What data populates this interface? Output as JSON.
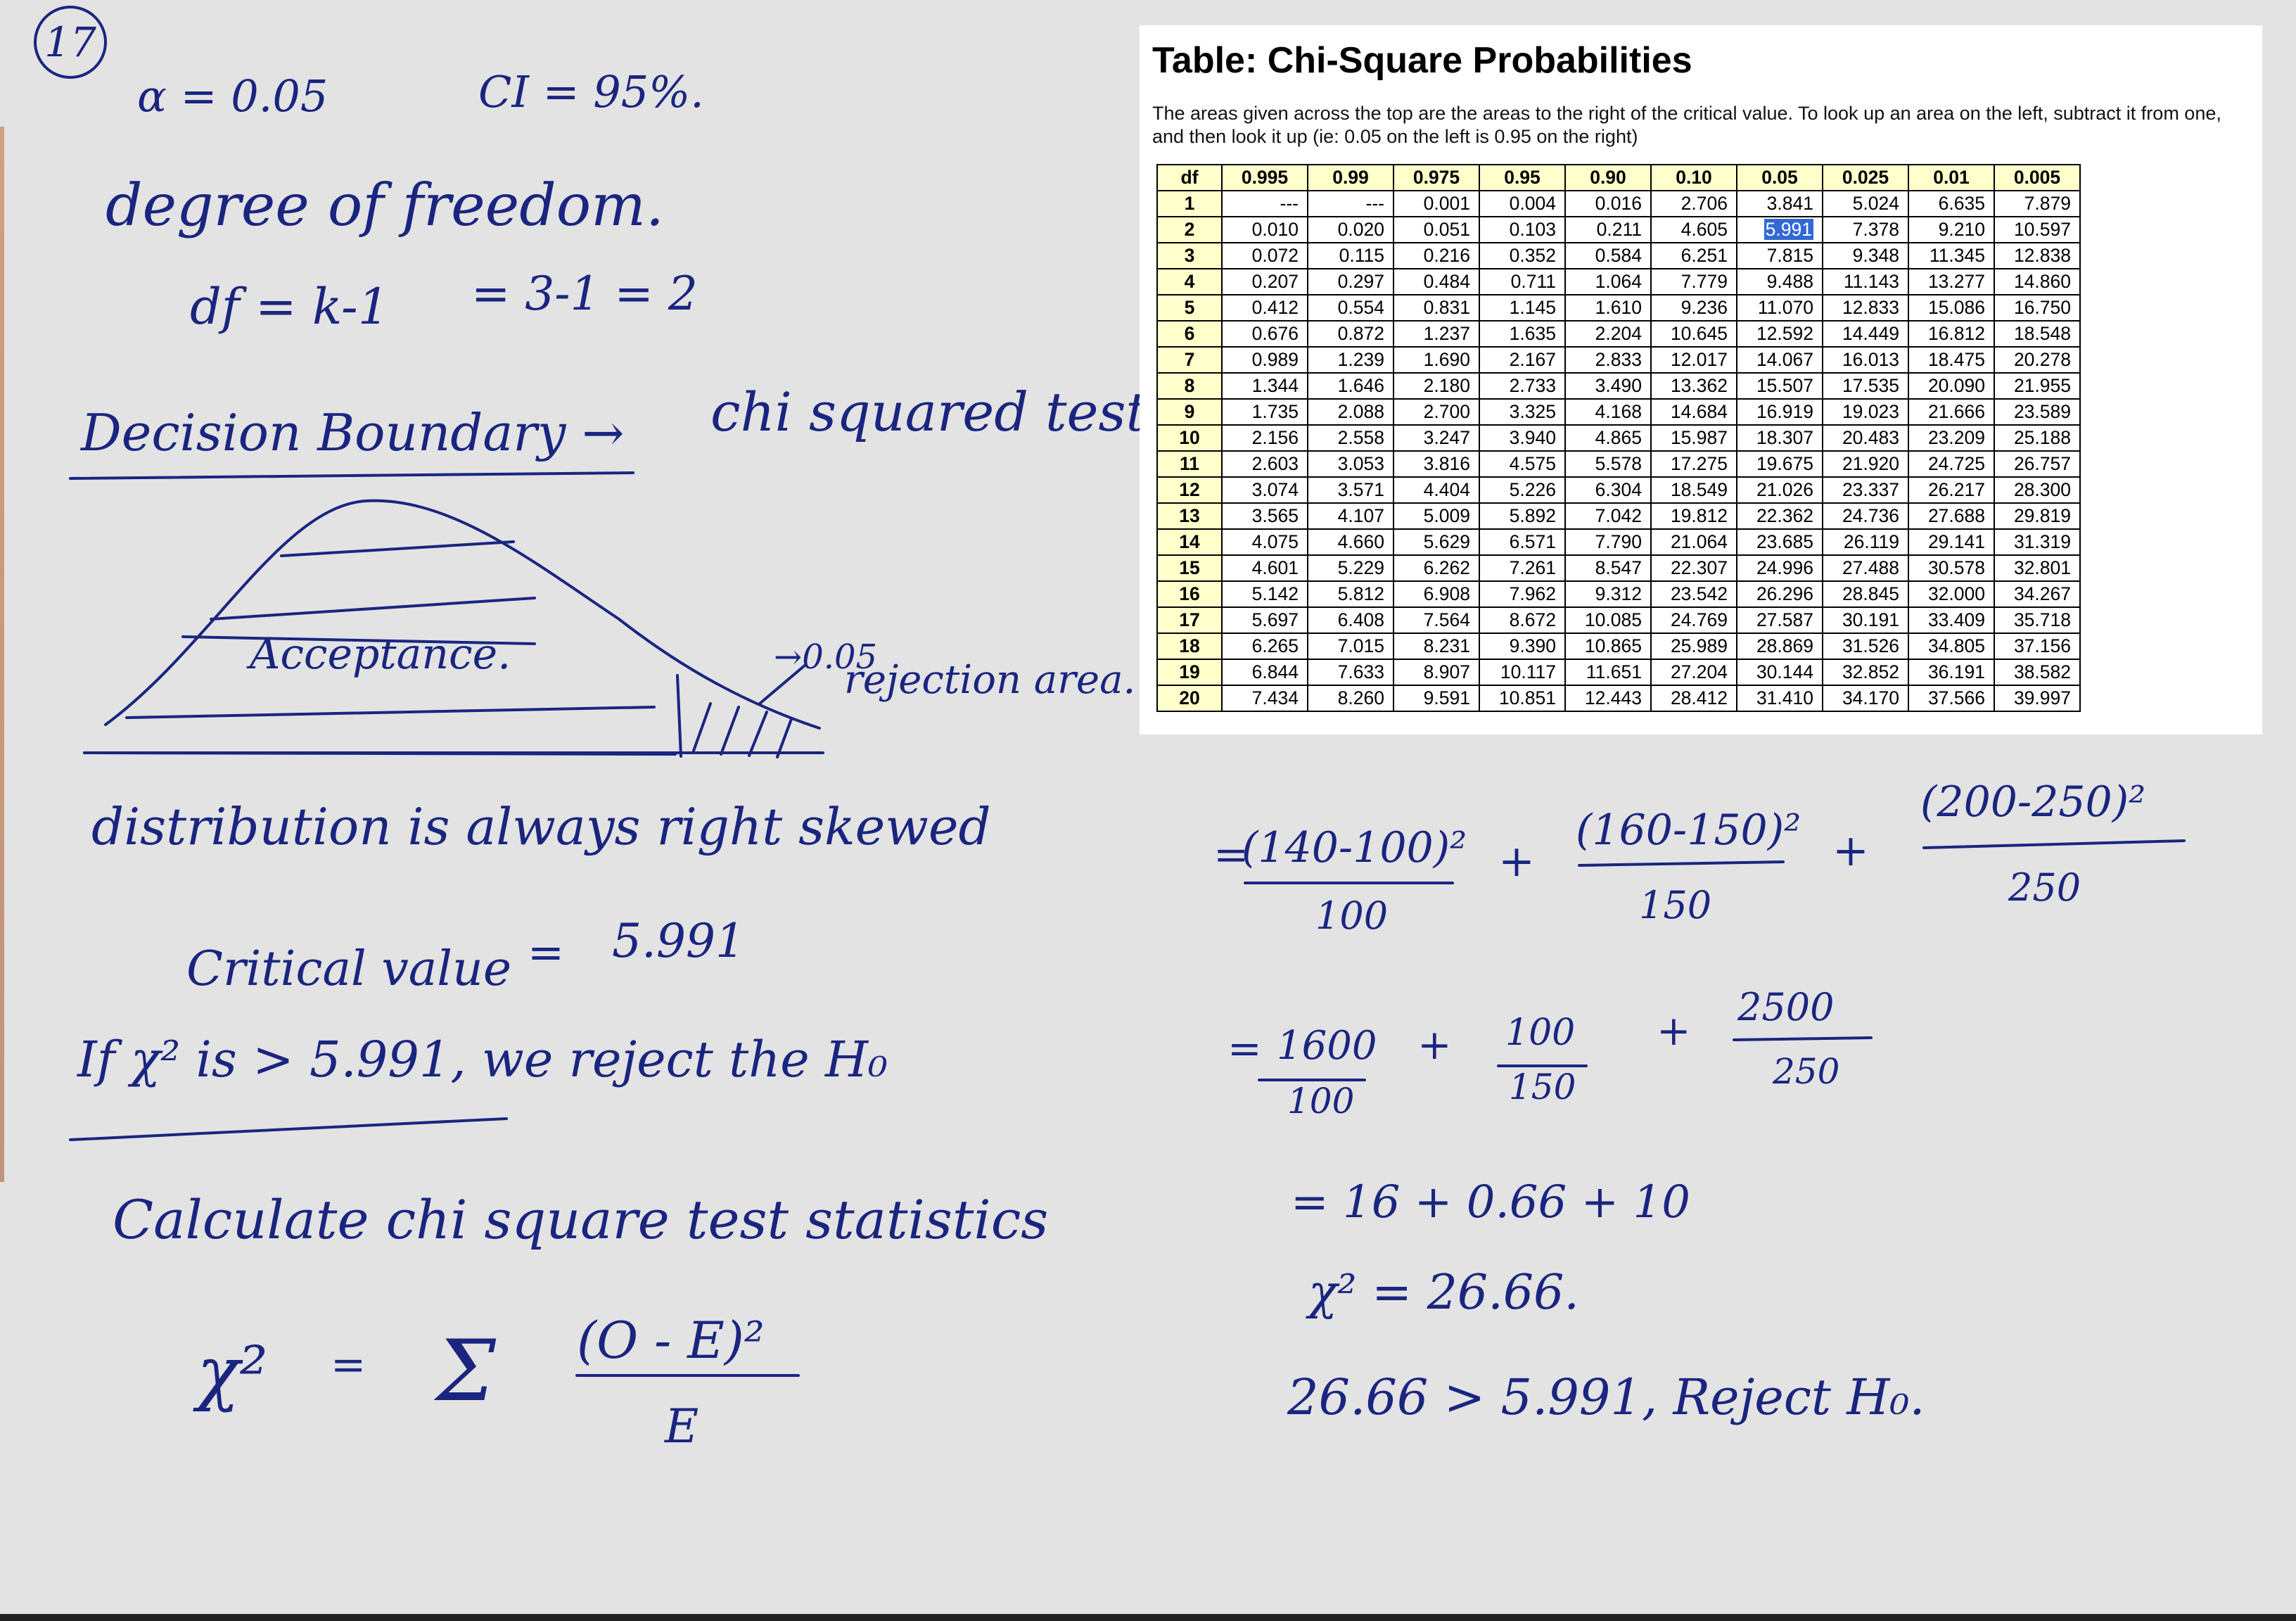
{
  "handwritten_notes": {
    "problem_number": "17",
    "alpha": "α = 0.05",
    "ci": "CI = 95%.",
    "dof_heading": "degree of freedom.",
    "dof_formula": "df = k-1",
    "dof_value": "= 3-1 = 2",
    "decision_boundary": "Decision Boundary →",
    "chi_test": "chi squared test",
    "acceptance": "Acceptance.",
    "rejection_value": "→0.05",
    "rejection_area": "rejection area.",
    "distribution_note": "distribution is always right skewed",
    "critical_label": "Critical value",
    "critical_eq": "=",
    "critical_value": "5.991",
    "if_rule": "If χ² is > 5.991,  we reject the H₀",
    "calculate_heading": "Calculate chi square test statistics",
    "formula_lhs": "χ²",
    "formula_eq": "=",
    "formula_sum": "Σ",
    "formula_num": "(O - E)²",
    "formula_den": "E",
    "calc_eq1": "=",
    "term1_num": "(140-100)²",
    "term1_den": "100",
    "plus1": "+",
    "term2_num": "(160-150)²",
    "term2_den": "150",
    "plus2": "+",
    "term3_num": "(200-250)²",
    "term3_den": "250",
    "calc_eq2": "=",
    "term4_num": "1600",
    "term4_den": "100",
    "plus3": "+",
    "term5_num": "100",
    "term5_den": "150",
    "plus4": "+",
    "term6_num": "2500",
    "term6_den": "250",
    "sum_line": "= 16 + 0.66 + 10",
    "result_line": "χ² = 26.66.",
    "conclusion_line": "26.66 > 5.991,  Reject H₀."
  },
  "table": {
    "title": "Table: Chi-Square Probabilities",
    "description": "The areas given across the top are the areas to the right of the critical value. To look up an area on the left, subtract it from one, and then look it up (ie: 0.05 on the left is 0.95 on the right)",
    "headers": [
      "df",
      "0.995",
      "0.99",
      "0.975",
      "0.95",
      "0.90",
      "0.10",
      "0.05",
      "0.025",
      "0.01",
      "0.005"
    ],
    "highlighted": {
      "row": 1,
      "col": 7
    },
    "rows": [
      [
        "1",
        "---",
        "---",
        "0.001",
        "0.004",
        "0.016",
        "2.706",
        "3.841",
        "5.024",
        "6.635",
        "7.879"
      ],
      [
        "2",
        "0.010",
        "0.020",
        "0.051",
        "0.103",
        "0.211",
        "4.605",
        "5.991",
        "7.378",
        "9.210",
        "10.597"
      ],
      [
        "3",
        "0.072",
        "0.115",
        "0.216",
        "0.352",
        "0.584",
        "6.251",
        "7.815",
        "9.348",
        "11.345",
        "12.838"
      ],
      [
        "4",
        "0.207",
        "0.297",
        "0.484",
        "0.711",
        "1.064",
        "7.779",
        "9.488",
        "11.143",
        "13.277",
        "14.860"
      ],
      [
        "5",
        "0.412",
        "0.554",
        "0.831",
        "1.145",
        "1.610",
        "9.236",
        "11.070",
        "12.833",
        "15.086",
        "16.750"
      ],
      [
        "6",
        "0.676",
        "0.872",
        "1.237",
        "1.635",
        "2.204",
        "10.645",
        "12.592",
        "14.449",
        "16.812",
        "18.548"
      ],
      [
        "7",
        "0.989",
        "1.239",
        "1.690",
        "2.167",
        "2.833",
        "12.017",
        "14.067",
        "16.013",
        "18.475",
        "20.278"
      ],
      [
        "8",
        "1.344",
        "1.646",
        "2.180",
        "2.733",
        "3.490",
        "13.362",
        "15.507",
        "17.535",
        "20.090",
        "21.955"
      ],
      [
        "9",
        "1.735",
        "2.088",
        "2.700",
        "3.325",
        "4.168",
        "14.684",
        "16.919",
        "19.023",
        "21.666",
        "23.589"
      ],
      [
        "10",
        "2.156",
        "2.558",
        "3.247",
        "3.940",
        "4.865",
        "15.987",
        "18.307",
        "20.483",
        "23.209",
        "25.188"
      ],
      [
        "11",
        "2.603",
        "3.053",
        "3.816",
        "4.575",
        "5.578",
        "17.275",
        "19.675",
        "21.920",
        "24.725",
        "26.757"
      ],
      [
        "12",
        "3.074",
        "3.571",
        "4.404",
        "5.226",
        "6.304",
        "18.549",
        "21.026",
        "23.337",
        "26.217",
        "28.300"
      ],
      [
        "13",
        "3.565",
        "4.107",
        "5.009",
        "5.892",
        "7.042",
        "19.812",
        "22.362",
        "24.736",
        "27.688",
        "29.819"
      ],
      [
        "14",
        "4.075",
        "4.660",
        "5.629",
        "6.571",
        "7.790",
        "21.064",
        "23.685",
        "26.119",
        "29.141",
        "31.319"
      ],
      [
        "15",
        "4.601",
        "5.229",
        "6.262",
        "7.261",
        "8.547",
        "22.307",
        "24.996",
        "27.488",
        "30.578",
        "32.801"
      ],
      [
        "16",
        "5.142",
        "5.812",
        "6.908",
        "7.962",
        "9.312",
        "23.542",
        "26.296",
        "28.845",
        "32.000",
        "34.267"
      ],
      [
        "17",
        "5.697",
        "6.408",
        "7.564",
        "8.672",
        "10.085",
        "24.769",
        "27.587",
        "30.191",
        "33.409",
        "35.718"
      ],
      [
        "18",
        "6.265",
        "7.015",
        "8.231",
        "9.390",
        "10.865",
        "25.989",
        "28.869",
        "31.526",
        "34.805",
        "37.156"
      ],
      [
        "19",
        "6.844",
        "7.633",
        "8.907",
        "10.117",
        "11.651",
        "27.204",
        "30.144",
        "32.852",
        "36.191",
        "38.582"
      ],
      [
        "20",
        "7.434",
        "8.260",
        "9.591",
        "10.851",
        "12.443",
        "28.412",
        "31.410",
        "34.170",
        "37.566",
        "39.997"
      ]
    ]
  },
  "colors": {
    "paper": "#e3e3e3",
    "ink": "#1a2580",
    "table_header_bg": "#ffffcc",
    "highlight": "#3168d6"
  }
}
